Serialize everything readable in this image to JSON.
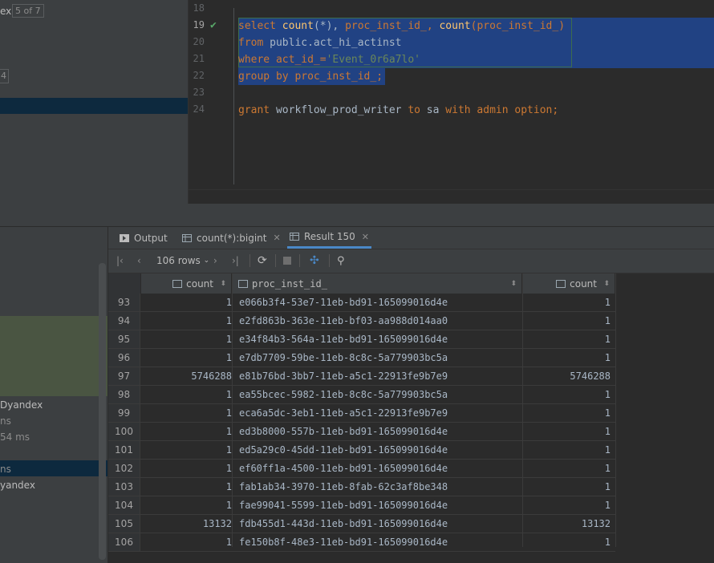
{
  "search": {
    "label_fragment": "ex",
    "match_count": "5 of 7",
    "badge_fragment": "4"
  },
  "editor": {
    "lines": [
      {
        "num": "18"
      },
      {
        "num": "19"
      },
      {
        "num": "20"
      },
      {
        "num": "21"
      },
      {
        "num": "22"
      },
      {
        "num": "23"
      },
      {
        "num": "24"
      }
    ],
    "code": {
      "l19_select": "select",
      "l19_count1": "count",
      "l19_star": "(*), ",
      "l19_proc": "proc_inst_id_, ",
      "l19_count2": "count",
      "l19_paren": "(proc_inst_id_)",
      "l20_from": "from",
      "l20_table": " public.act_hi_actinst",
      "l21_where": "where",
      "l21_col": " act_id_=",
      "l21_str": "'Event_0r6a7lo'",
      "l22_group": "group by",
      "l22_col": " proc_inst_id_;",
      "l24_grant": "grant",
      "l24_user": " workflow_prod_writer ",
      "l24_to": "to",
      "l24_sa": " sa ",
      "l24_with": "with admin option;"
    }
  },
  "left_panel": {
    "items": [
      {
        "text": "Dyandex"
      },
      {
        "text": "ns"
      },
      {
        "text": "54 ms"
      },
      {
        "text": "ns"
      },
      {
        "text": "yandex"
      }
    ]
  },
  "tabs": [
    {
      "label": "Output",
      "icon": "play-icon"
    },
    {
      "label": "count(*):bigint",
      "icon": "table-icon"
    },
    {
      "label": "Result 150",
      "icon": "table-icon"
    }
  ],
  "toolbar": {
    "rows_label": "106 rows"
  },
  "grid": {
    "columns": [
      "count",
      "proc_inst_id_",
      "count"
    ],
    "rows": [
      {
        "n": "93",
        "c1": "1",
        "id": "e066b3f4-53e7-11eb-bd91-165099016d4e",
        "c3": "1"
      },
      {
        "n": "94",
        "c1": "1",
        "id": "e2fd863b-363e-11eb-bf03-aa988d014aa0",
        "c3": "1"
      },
      {
        "n": "95",
        "c1": "1",
        "id": "e34f84b3-564a-11eb-bd91-165099016d4e",
        "c3": "1"
      },
      {
        "n": "96",
        "c1": "1",
        "id": "e7db7709-59be-11eb-8c8c-5a779903bc5a",
        "c3": "1"
      },
      {
        "n": "97",
        "c1": "5746288",
        "id": "e81b76bd-3bb7-11eb-a5c1-22913fe9b7e9",
        "c3": "5746288"
      },
      {
        "n": "98",
        "c1": "1",
        "id": "ea55bcec-5982-11eb-8c8c-5a779903bc5a",
        "c3": "1"
      },
      {
        "n": "99",
        "c1": "1",
        "id": "eca6a5dc-3eb1-11eb-a5c1-22913fe9b7e9",
        "c3": "1"
      },
      {
        "n": "100",
        "c1": "1",
        "id": "ed3b8000-557b-11eb-bd91-165099016d4e",
        "c3": "1"
      },
      {
        "n": "101",
        "c1": "1",
        "id": "ed5a29c0-45dd-11eb-bd91-165099016d4e",
        "c3": "1"
      },
      {
        "n": "102",
        "c1": "1",
        "id": "ef60ff1a-4500-11eb-bd91-165099016d4e",
        "c3": "1"
      },
      {
        "n": "103",
        "c1": "1",
        "id": "fab1ab34-3970-11eb-8fab-62c3af8be348",
        "c3": "1"
      },
      {
        "n": "104",
        "c1": "1",
        "id": "fae99041-5599-11eb-bd91-165099016d4e",
        "c3": "1"
      },
      {
        "n": "105",
        "c1": "13132",
        "id": "fdb455d1-443d-11eb-bd91-165099016d4e",
        "c3": "13132"
      },
      {
        "n": "106",
        "c1": "1",
        "id": "fe150b8f-48e3-11eb-bd91-165099016d4e",
        "c3": "1"
      }
    ]
  }
}
